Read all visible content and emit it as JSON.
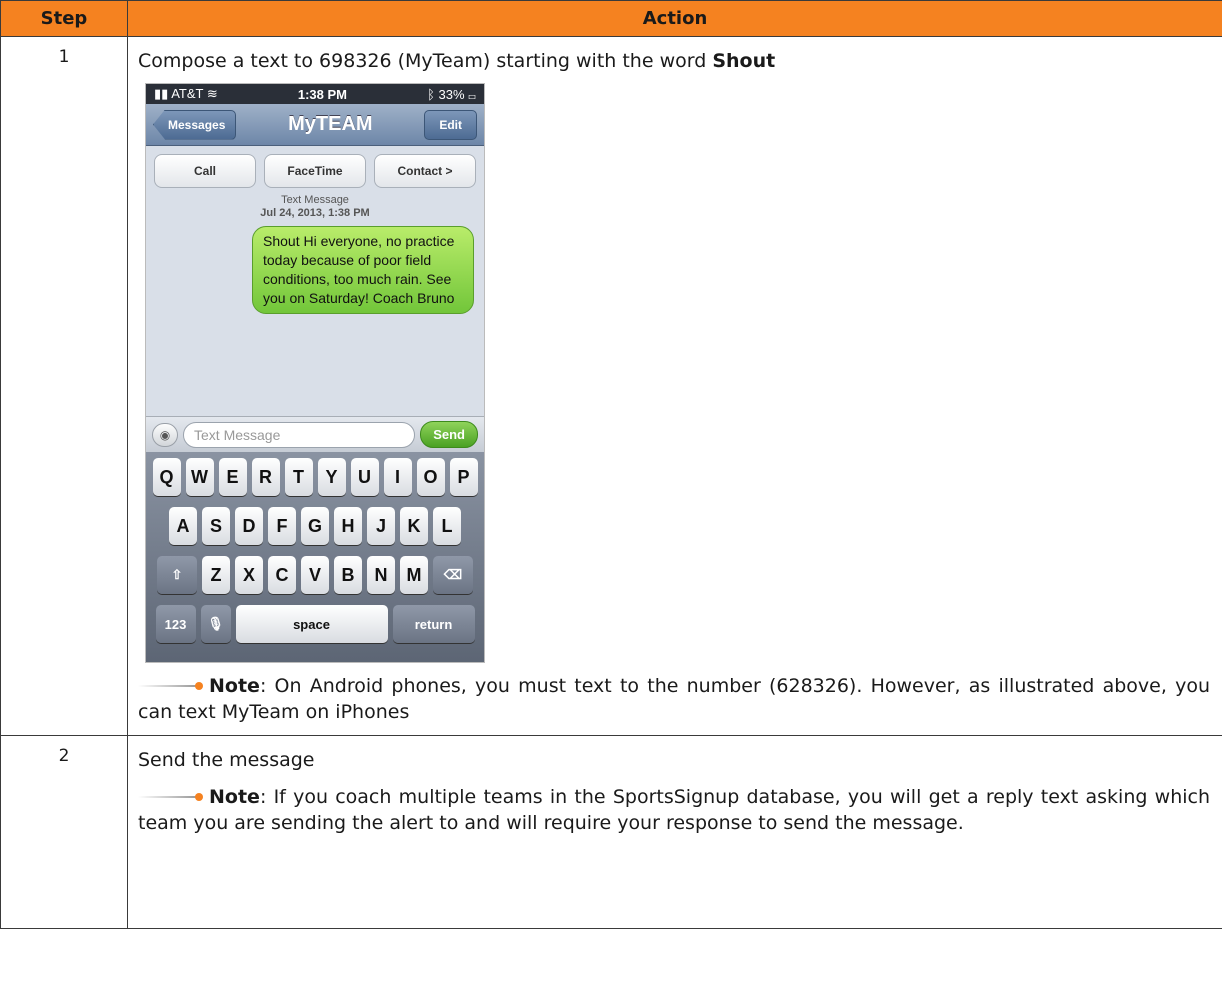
{
  "table": {
    "header_step": "Step",
    "header_action": "Action"
  },
  "step1": {
    "number": "1",
    "text_prefix": "Compose a text to 698326 (MyTeam) starting with the word ",
    "text_bold": "Shout",
    "note_label": "Note",
    "note_text": ": On Android phones, you must text to the number (628326). However, as illustrated above, you can text MyTeam on iPhones"
  },
  "step2": {
    "number": "2",
    "text": "Send the message",
    "note_label": "Note",
    "note_text": ": If you coach multiple teams in the SportsSignup database, you will get a reply text asking which team you are sending the alert to and will require your response to send the message."
  },
  "phone": {
    "carrier": "AT&T",
    "time": "1:38 PM",
    "battery": "33%",
    "back_button": "Messages",
    "title": "MyTEAM",
    "edit_button": "Edit",
    "call_button": "Call",
    "facetime_button": "FaceTime",
    "contact_button": "Contact >",
    "thread_label": "Text Message",
    "thread_date": "Jul 24, 2013, 1:38 PM",
    "message": "Shout Hi everyone, no practice today because of poor field conditions, too much rain. See you on Saturday! Coach Bruno",
    "input_placeholder": "Text Message",
    "send_button": "Send",
    "row1": [
      "Q",
      "W",
      "E",
      "R",
      "T",
      "Y",
      "U",
      "I",
      "O",
      "P"
    ],
    "row2": [
      "A",
      "S",
      "D",
      "F",
      "G",
      "H",
      "J",
      "K",
      "L"
    ],
    "row3": [
      "Z",
      "X",
      "C",
      "V",
      "B",
      "N",
      "M"
    ],
    "key_123": "123",
    "key_space": "space",
    "key_return": "return"
  }
}
